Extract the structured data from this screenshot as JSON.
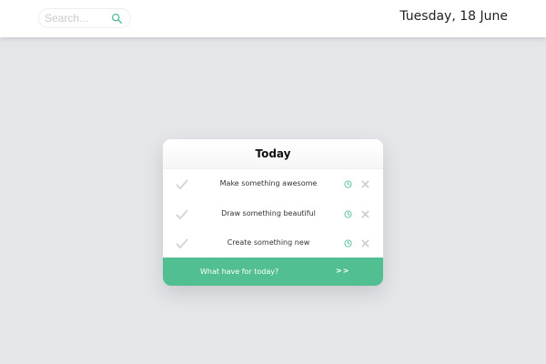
{
  "header": {
    "search": {
      "placeholder": "Search...",
      "value": ""
    },
    "date": "Tuesday, 18 June"
  },
  "todo": {
    "title": "Today",
    "tasks": [
      {
        "label": "Make something awesome"
      },
      {
        "label": "Draw something beautiful"
      },
      {
        "label": "Create something new"
      }
    ],
    "input_prompt": "What have for today?",
    "submit_label": ">>"
  },
  "icons": {
    "search": "search-icon",
    "check": "check-icon",
    "clock": "clock-icon",
    "delete": "close-icon"
  },
  "colors": {
    "accent": "#52bf92",
    "background": "#e5e6ea",
    "icon_muted": "#d6d6d6"
  }
}
